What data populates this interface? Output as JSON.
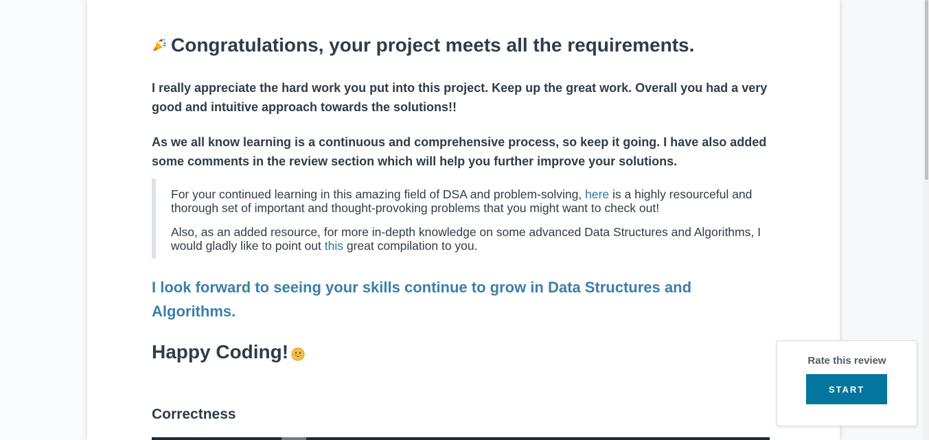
{
  "review": {
    "heading": "Congratulations, your project meets all the requirements.",
    "paragraph1": "I really appreciate the hard work you put into this project. Keep up the great work. Overall you had a very good and intuitive approach towards the solutions!!",
    "paragraph2": "As we all know learning is a continuous and comprehensive process, so keep it going. I have also added some comments in the review section which will help you further improve your solutions.",
    "quote1_before": "For your continued learning in this amazing field of DSA and problem-solving, ",
    "quote1_link": "here",
    "quote1_after": " is a highly resourceful and thorough set of important and thought-provoking problems that you might want to check out!",
    "quote2_before": "Also, as an added resource, for more in-depth knowledge on some advanced Data Structures and Algorithms, I would gladly like to point out ",
    "quote2_link": "this",
    "quote2_after": " great compilation to you.",
    "forward_text": "I look forward to seeing your skills continue to grow in Data Structures and Algorithms.",
    "happy_coding": "Happy Coding!",
    "section_heading": "Correctness"
  },
  "rating": {
    "label": "Rate this review",
    "button_label": "START"
  },
  "icons": {
    "heading_icon": "party-popper-icon",
    "happy_icon": "grinning-face-icon"
  },
  "colors": {
    "text": "#2e3d49",
    "link": "#2a7a9b",
    "accent": "#02769c"
  }
}
